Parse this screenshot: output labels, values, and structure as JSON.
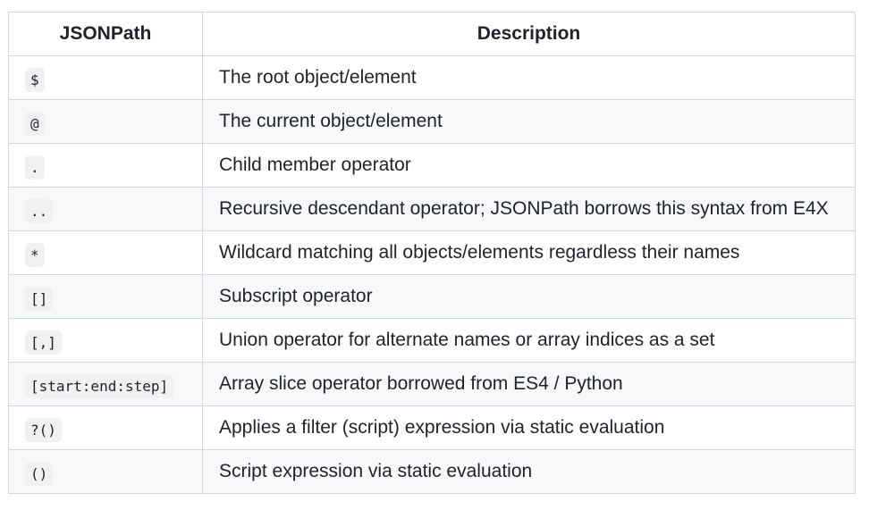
{
  "table": {
    "headers": {
      "path": "JSONPath",
      "description": "Description"
    },
    "rows": [
      {
        "path": "$",
        "description": "The root object/element"
      },
      {
        "path": "@",
        "description": "The current object/element"
      },
      {
        "path": ".",
        "description": "Child member operator"
      },
      {
        "path": "..",
        "description": "Recursive descendant operator; JSONPath borrows this syntax from E4X"
      },
      {
        "path": "*",
        "description": "Wildcard matching all objects/elements regardless their names"
      },
      {
        "path": "[]",
        "description": "Subscript operator"
      },
      {
        "path": "[,]",
        "description": "Union operator for alternate names or array indices as a set"
      },
      {
        "path": "[start:end:step]",
        "description": "Array slice operator borrowed from ES4 / Python"
      },
      {
        "path": "?()",
        "description": "Applies a filter (script) expression via static evaluation"
      },
      {
        "path": "()",
        "description": "Script expression via static evaluation"
      }
    ]
  }
}
